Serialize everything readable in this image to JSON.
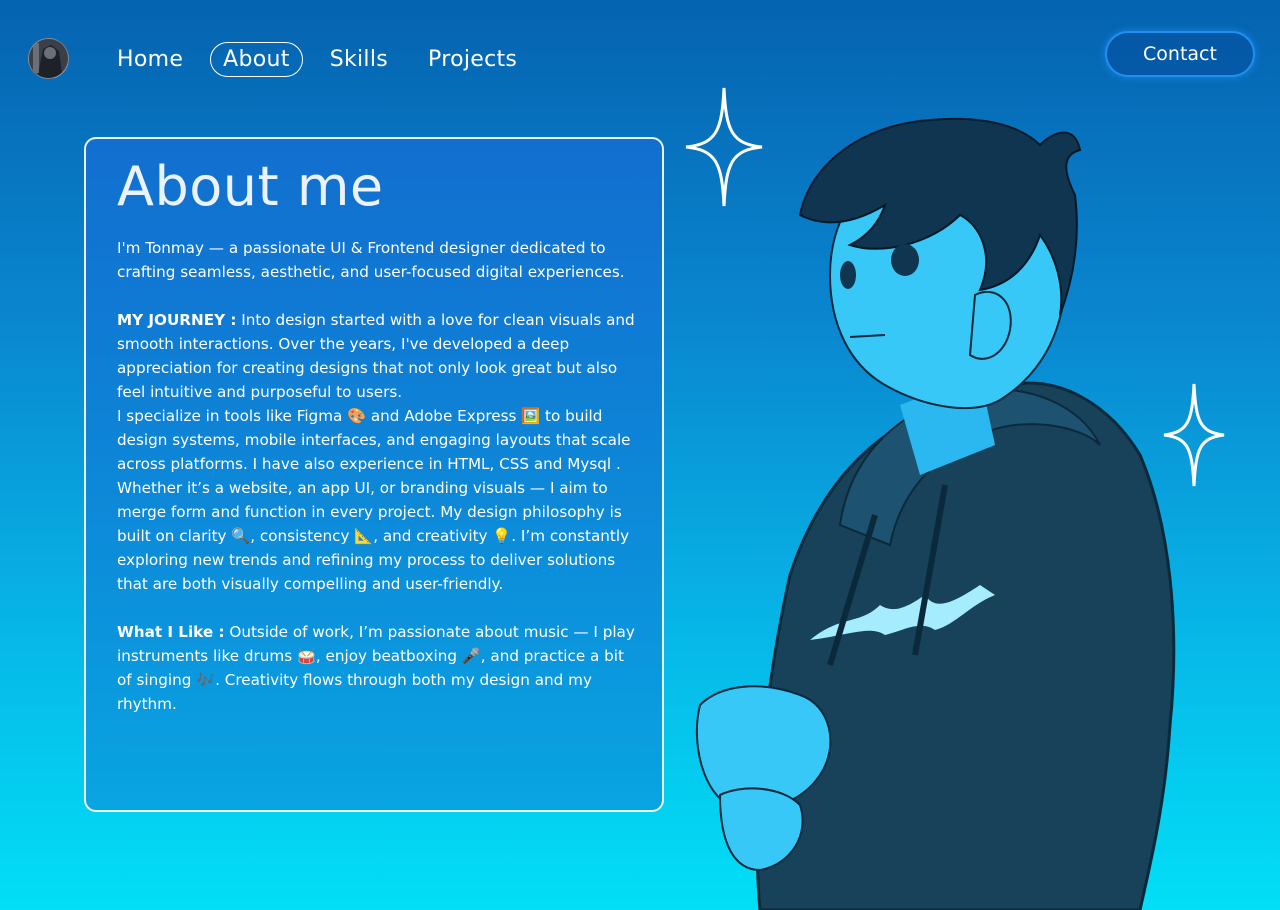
{
  "nav": {
    "items": [
      {
        "label": "Home"
      },
      {
        "label": "About"
      },
      {
        "label": "Skills"
      },
      {
        "label": "Projects"
      }
    ],
    "active": "About",
    "contact_label": "Contact"
  },
  "about": {
    "title": "About me",
    "intro": "I'm Tonmay — a passionate UI & Frontend designer dedicated to crafting seamless, aesthetic, and user-focused digital experiences.",
    "journey_label": "MY JOURNEY :",
    "journey_text": " Into design started with a love for clean visuals and smooth interactions. Over the years, I've developed a deep appreciation for creating designs that not only look great but also feel intuitive and purposeful to users.",
    "specialize_text": "I specialize in tools like Figma 🎨 and Adobe Express 🖼️ to build design systems, mobile interfaces, and engaging layouts that scale across platforms. I have also experience in HTML, CSS and Mysql . Whether it’s a website, an app UI, or branding visuals — I aim to merge form and function in every project. My design philosophy is built on clarity 🔍, consistency 📐, and creativity 💡. I’m constantly exploring new trends and refining my process to deliver solutions that are both visually compelling and user-friendly.",
    "like_label": "What I Like :",
    "like_text": " Outside of work, I’m passionate about music — I play instruments like drums 🥁, enjoy beatboxing 🎤, and practice a bit of singing 🎶. Creativity flows through both my design and my rhythm."
  },
  "colors": {
    "bg_top": "#0563b0",
    "bg_bottom": "#02dff6",
    "contact_border": "#1f8ff0"
  },
  "icons": [
    "avatar",
    "sparkle-icon",
    "sparkle-icon"
  ]
}
